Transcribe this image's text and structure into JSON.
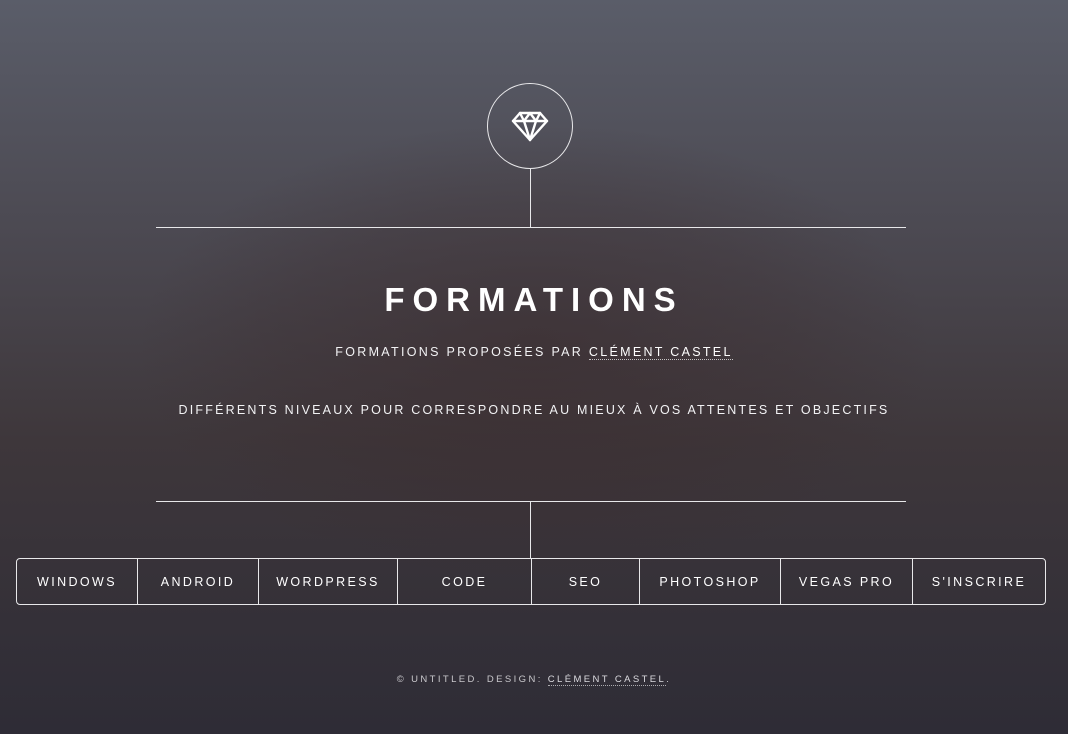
{
  "header": {
    "logo_icon": "diamond-icon",
    "title": "FORMATIONS",
    "subtitle_prefix": "FORMATIONS PROPOSÉES PAR ",
    "subtitle_link": "CLÉMENT CASTEL",
    "tagline": "DIFFÉRENTS NIVEAUX POUR CORRESPONDRE AU MIEUX À VOS ATTENTES ET OBJECTIFS"
  },
  "nav": {
    "items": [
      {
        "label": "WINDOWS"
      },
      {
        "label": "ANDROID"
      },
      {
        "label": "WORDPRESS"
      },
      {
        "label": "CODE"
      },
      {
        "label": "SEO"
      },
      {
        "label": "PHOTOSHOP"
      },
      {
        "label": "VEGAS PRO"
      },
      {
        "label": "S'INSCRIRE"
      }
    ]
  },
  "footer": {
    "copyright": "© UNTITLED. DESIGN: ",
    "design_link": "CLÉMENT CASTEL",
    "suffix": "."
  },
  "colors": {
    "line": "#e8e8ea",
    "text": "#ffffff",
    "background_top": "#5a5d69",
    "background_bottom": "#2e2c36"
  }
}
